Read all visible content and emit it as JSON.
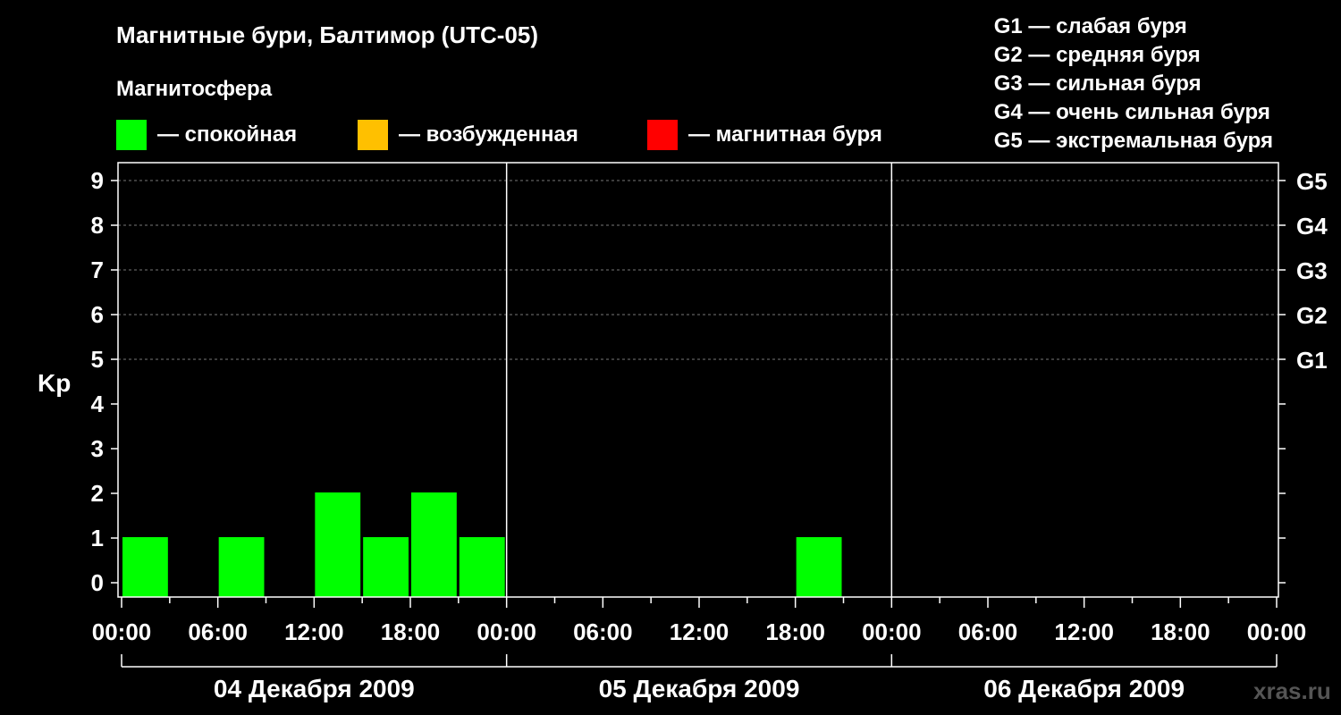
{
  "chart_data": {
    "type": "bar",
    "title": "Магнитные бури, Балтимор (UTC-05)",
    "subtitle": "Магнитосфера",
    "ylabel": "Kp",
    "ylim": [
      0,
      9
    ],
    "y_ticks": [
      "0",
      "1",
      "2",
      "3",
      "4",
      "5",
      "6",
      "7",
      "8",
      "9"
    ],
    "y2_labels": [
      {
        "value": 5,
        "label": "G1"
      },
      {
        "value": 6,
        "label": "G2"
      },
      {
        "value": 7,
        "label": "G3"
      },
      {
        "value": 8,
        "label": "G4"
      },
      {
        "value": 9,
        "label": "G5"
      }
    ],
    "x_range_hours": [
      0,
      72
    ],
    "x_tick_labels": [
      "00:00",
      "06:00",
      "12:00",
      "18:00",
      "00:00",
      "06:00",
      "12:00",
      "18:00",
      "00:00",
      "06:00",
      "12:00",
      "18:00",
      "00:00"
    ],
    "days": [
      "04 Декабря 2009",
      "05 Декабря 2009",
      "06 Декабря 2009"
    ],
    "grid": true,
    "magnetosphere_legend": [
      {
        "color": "#00ff00",
        "label": "— спокойная"
      },
      {
        "color": "#ffc000",
        "label": "— возбужденная"
      },
      {
        "color": "#ff0000",
        "label": "— магнитная буря"
      }
    ],
    "storm_legend": [
      "G1 — слабая буря",
      "G2 — средняя буря",
      "G3 — сильная буря",
      "G4 — очень сильная буря",
      "G5 — экстремальная буря"
    ],
    "bar_color": "#00ff00",
    "bars": [
      {
        "start": 0,
        "end": 3,
        "kp": 1
      },
      {
        "start": 6,
        "end": 9,
        "kp": 1
      },
      {
        "start": 12,
        "end": 15,
        "kp": 2
      },
      {
        "start": 15,
        "end": 18,
        "kp": 1
      },
      {
        "start": 18,
        "end": 21,
        "kp": 2
      },
      {
        "start": 21,
        "end": 24,
        "kp": 1
      },
      {
        "start": 42,
        "end": 45,
        "kp": 1
      }
    ]
  },
  "watermark": "xras.ru"
}
